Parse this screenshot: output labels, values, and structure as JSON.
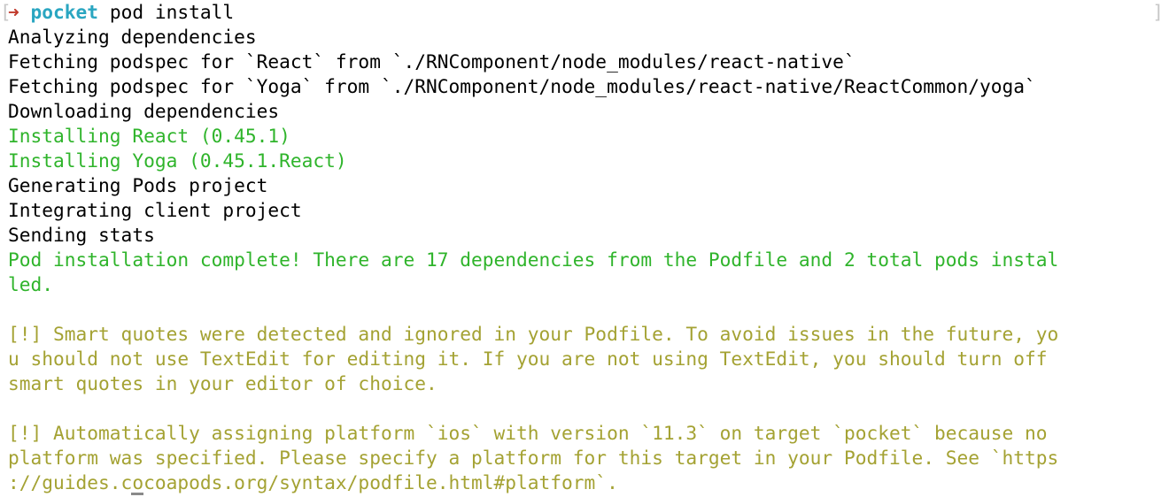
{
  "prompt": {
    "symbol": "➜",
    "directory": "pocket",
    "command": "pod install",
    "bracket_open": "[",
    "bracket_close": "]"
  },
  "output": [
    {
      "text": "Analyzing dependencies",
      "kind": "normal"
    },
    {
      "text": "Fetching podspec for `React` from `./RNComponent/node_modules/react-native`",
      "kind": "normal"
    },
    {
      "text": "Fetching podspec for `Yoga` from `./RNComponent/node_modules/react-native/ReactCommon/yoga`",
      "kind": "normal"
    },
    {
      "text": "Downloading dependencies",
      "kind": "normal"
    },
    {
      "text": "Installing React (0.45.1)",
      "kind": "success"
    },
    {
      "text": "Installing Yoga (0.45.1.React)",
      "kind": "success"
    },
    {
      "text": "Generating Pods project",
      "kind": "normal"
    },
    {
      "text": "Integrating client project",
      "kind": "normal"
    },
    {
      "text": "Sending stats",
      "kind": "normal"
    },
    {
      "text": "Pod installation complete! There are 17 dependencies from the Podfile and 2 total pods instal",
      "kind": "success"
    },
    {
      "text": "led.",
      "kind": "success"
    },
    {
      "text": "",
      "kind": "normal"
    },
    {
      "text": "[!] Smart quotes were detected and ignored in your Podfile. To avoid issues in the future, yo",
      "kind": "warning"
    },
    {
      "text": "u should not use TextEdit for editing it. If you are not using TextEdit, you should turn off",
      "kind": "warning"
    },
    {
      "text": "smart quotes in your editor of choice.",
      "kind": "warning"
    },
    {
      "text": "",
      "kind": "normal"
    },
    {
      "text": "[!] Automatically assigning platform `ios` with version `11.3` on target `pocket` because no",
      "kind": "warning"
    },
    {
      "text": "platform was specified. Please specify a platform for this target in your Podfile. See `https",
      "kind": "warning"
    },
    {
      "text": "://guides.cocoapods.org/syntax/podfile.html#platform`.",
      "kind": "warning"
    }
  ],
  "colors": {
    "success": "#2fb42b",
    "warning": "#a4a233",
    "prompt_arrow": "#c0392b",
    "prompt_dir": "#2aa6c1"
  }
}
